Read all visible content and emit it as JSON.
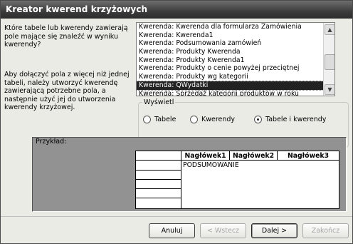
{
  "window": {
    "title": "Kreator kwerend krzyżowych"
  },
  "instructions": {
    "top": [
      "Które tabele lub kwerendy zawierają",
      "pole mające się znaleźć w wyniku",
      "kwerendy?"
    ],
    "bottom": [
      "Aby dołączyć pola z więcej niż jednej",
      "tabeli, należy utworzyć kwerendę",
      "zawierającą potrzebne pola, a",
      "następnie użyć jej do utworzenia",
      "kwerendy krzyżowej."
    ]
  },
  "list": {
    "items": [
      "Kwerenda: Kwerenda dla formularza Zamówienia",
      "Kwerenda: Kwerenda1",
      "Kwerenda: Podsumowania zamówień",
      "Kwerenda: Produkty Kwerenda",
      "Kwerenda: Produkty Kwerenda1",
      "Kwerenda: Produkty o cenie powyżej przeciętnej",
      "Kwerenda: Produkty wg kategorii",
      "Kwerenda: QWydatki",
      "Kwerenda: Sprzedaż kategorii produktów w roku"
    ],
    "selected_index": 7
  },
  "view_group": {
    "legend": "Wyświetl",
    "options": [
      "Tabele",
      "Kwerendy",
      "Tabele i kwerendy"
    ],
    "selected": "Tabele i kwerendy"
  },
  "sample": {
    "label": "Przykład:",
    "headers": [
      "Nagłówek1",
      "Nagłówek2",
      "Nagłówek3"
    ],
    "summary_cell": "PODSUMOWANIE"
  },
  "buttons": {
    "cancel": "Anuluj",
    "back": "< Wstecz",
    "next": "Dalej >",
    "finish": "Zakończ"
  }
}
